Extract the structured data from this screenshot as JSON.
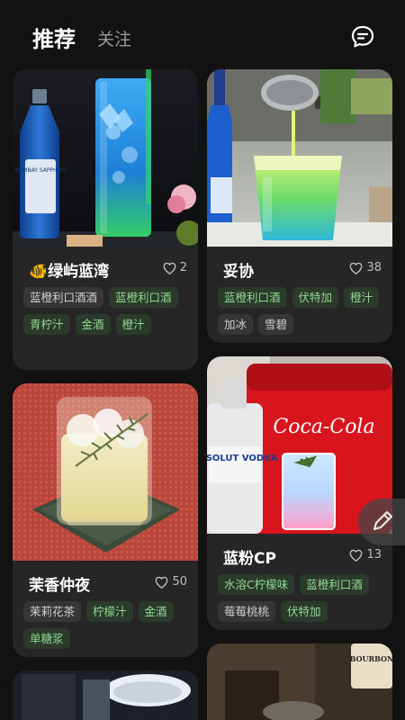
{
  "header": {
    "tabs": [
      {
        "label": "推荐",
        "active": true
      },
      {
        "label": "关注",
        "active": false
      }
    ],
    "message_icon": "chat-bubble-icon"
  },
  "cards": [
    {
      "title": "绿屿蓝湾",
      "title_emoji": "🐠",
      "likes": "2",
      "tags": [
        {
          "label": "蓝橙利口酒酒",
          "highlight": false
        },
        {
          "label": "蓝橙利口酒",
          "highlight": true
        },
        {
          "label": "青柠汁",
          "highlight": true
        },
        {
          "label": "金酒",
          "highlight": true
        },
        {
          "label": "橙汁",
          "highlight": true
        }
      ],
      "bottle_text": "BOMBAY SAPPHIRE"
    },
    {
      "title": "妥协",
      "likes": "38",
      "tags": [
        {
          "label": "蓝橙利口酒",
          "highlight": true
        },
        {
          "label": "伏特加",
          "highlight": true
        },
        {
          "label": "橙汁",
          "highlight": true
        },
        {
          "label": "加冰",
          "highlight": false
        },
        {
          "label": "雪碧",
          "highlight": false
        }
      ]
    },
    {
      "title": "茉香仲夜",
      "likes": "50",
      "tags": [
        {
          "label": "茉莉花茶",
          "highlight": false
        },
        {
          "label": "柠檬汁",
          "highlight": true
        },
        {
          "label": "金酒",
          "highlight": true
        },
        {
          "label": "单糖浆",
          "highlight": true
        }
      ]
    },
    {
      "title": "蓝粉CP",
      "likes": "13",
      "tags": [
        {
          "label": "水溶C柠檬味",
          "highlight": true
        },
        {
          "label": "蓝橙利口酒",
          "highlight": true
        },
        {
          "label": "莓莓桃桃",
          "highlight": false
        },
        {
          "label": "伏特加",
          "highlight": true
        }
      ],
      "cooler_text": "Coca-Cola",
      "bottle_text": "ABSOLUT VODKA"
    }
  ],
  "partial_card_text": "BOURBON",
  "colors": {
    "background": "#121212",
    "card": "#262626",
    "tag_green_text": "#8fd98f",
    "tag_green_bg": "#2c3a2c"
  }
}
